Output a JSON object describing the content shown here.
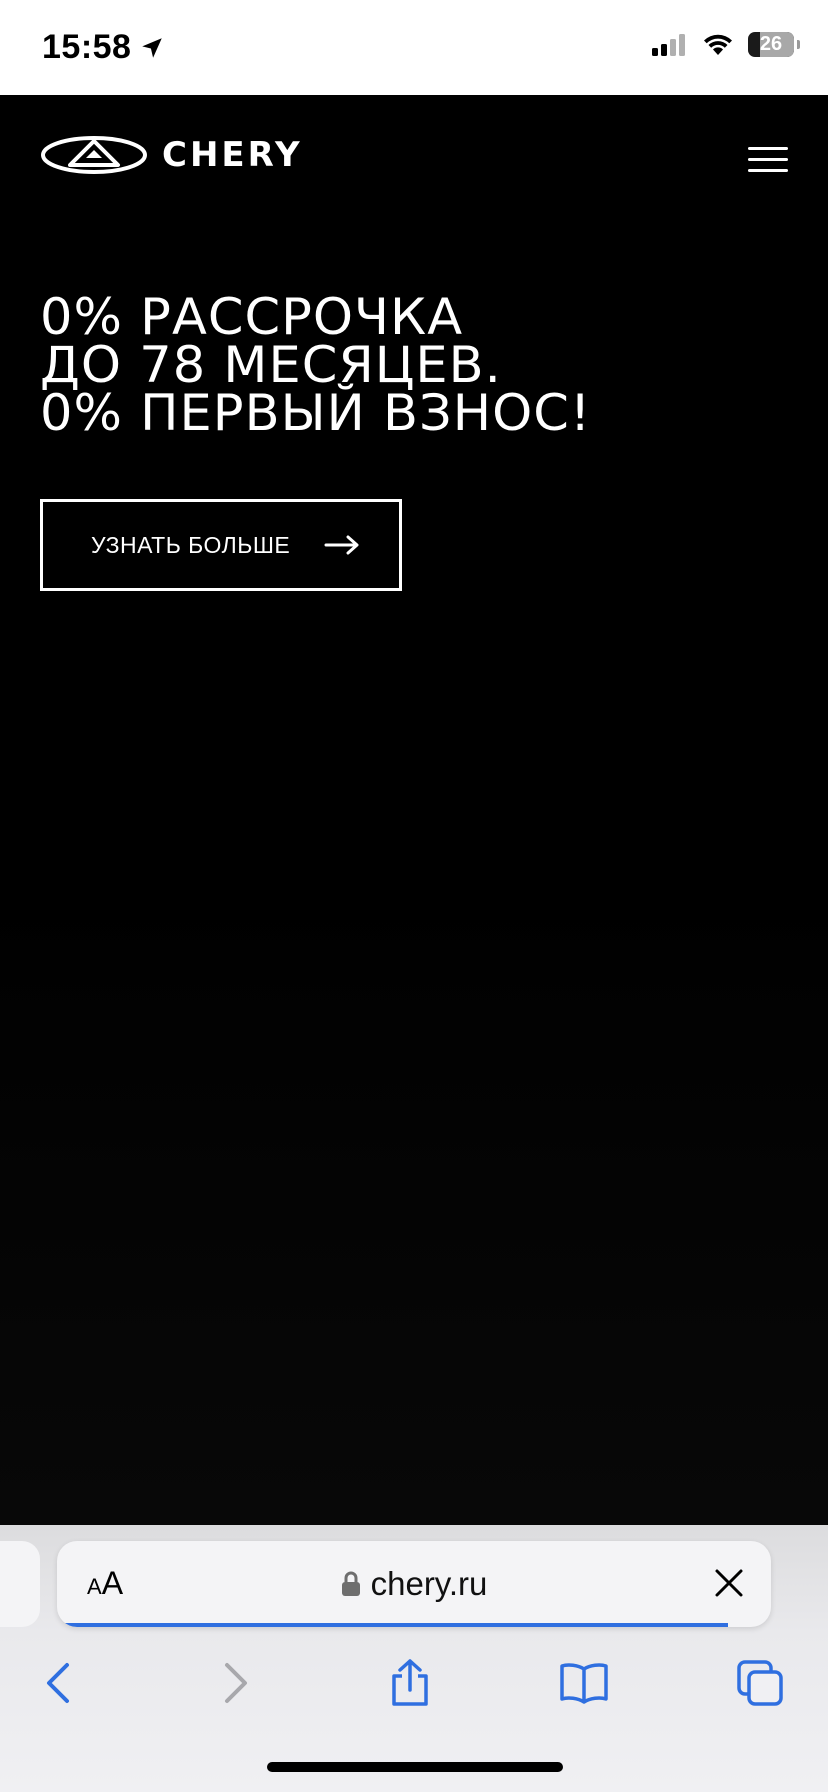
{
  "status_bar": {
    "time": "15:58",
    "battery_level": "26",
    "battery_fraction": 0.26
  },
  "site": {
    "brand": "CHERY",
    "hero": {
      "lines": [
        "0% РАССРОЧКА",
        "ДО 78 МЕСЯЦЕВ.",
        "0% ПЕРВЫЙ ВЗНОС!"
      ]
    },
    "cta_label": "УЗНАТЬ БОЛЬШЕ"
  },
  "browser": {
    "text_size_label_small": "A",
    "text_size_label_large": "A",
    "url": "chery.ru",
    "load_progress": 0.94,
    "accent_color": "#2f6fe0"
  },
  "colors": {
    "page_background": "#000000",
    "text": "#ffffff"
  }
}
